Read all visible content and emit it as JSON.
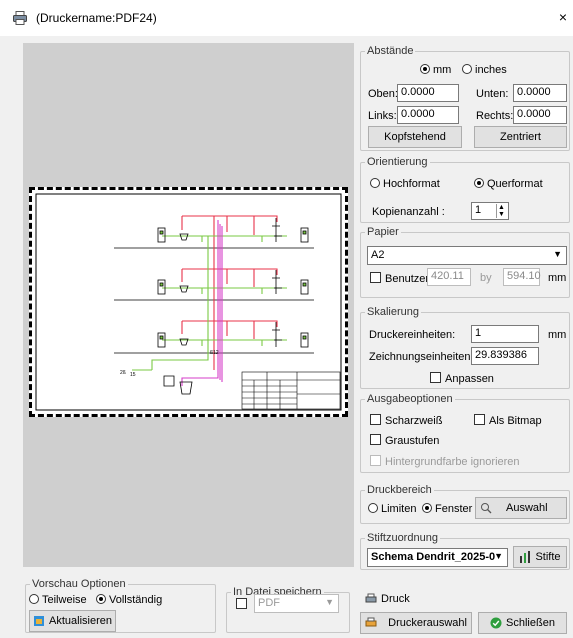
{
  "window": {
    "title": "(Druckername:PDF24)",
    "close": "×"
  },
  "abstaende": {
    "legend": "Abstände",
    "unit_mm": "mm",
    "unit_inches": "inches",
    "unit_selected": "mm",
    "oben_label": "Oben:",
    "oben": "0.0000",
    "unten_label": "Unten:",
    "unten": "0.0000",
    "links_label": "Links:",
    "links": "0.0000",
    "rechts_label": "Rechts:",
    "rechts": "0.0000",
    "kopfstehend": "Kopfstehend",
    "zentriert": "Zentriert"
  },
  "orientierung": {
    "legend": "Orientierung",
    "hochformat": "Hochformat",
    "querformat": "Querformat",
    "selected": "Querformat",
    "kopien_label": "Kopienanzahl :",
    "kopien": "1"
  },
  "papier": {
    "legend": "Papier",
    "format": "A2",
    "benutzer": "Benutzer",
    "width": "420.11",
    "by": "by",
    "height": "594.10",
    "unit": "mm"
  },
  "skalierung": {
    "legend": "Skalierung",
    "drucker_label": "Druckereinheiten:",
    "drucker": "1",
    "drucker_unit": "mm",
    "zeichnung_label": "Zeichnungseinheiten:",
    "zeichnung": "29.839386",
    "anpassen": "Anpassen"
  },
  "ausgabe": {
    "legend": "Ausgabeoptionen",
    "schwarzweiss": "Scharzweiß",
    "bitmap": "Als Bitmap",
    "graustufen": "Graustufen",
    "hintergrund": "Hintergrundfarbe ignorieren"
  },
  "druckbereich": {
    "legend": "Druckbereich",
    "limiten": "Limiten",
    "fenster": "Fenster",
    "auswahl": "Auswahl",
    "selected": "Fenster"
  },
  "stift": {
    "legend": "Stiftzuordnung",
    "schema": "Schema Dendrit_2025-0",
    "stifte": "Stifte"
  },
  "vorschau": {
    "legend": "Vorschau Optionen",
    "teilweise": "Teilweise",
    "vollstaendig": "Vollständig",
    "selected": "Vollständig",
    "aktualisieren": "Aktualisieren"
  },
  "datei": {
    "legend": "In Datei speichern",
    "format": "PDF"
  },
  "actions": {
    "druck": "Druck",
    "druckerauswahl": "Druckerauswahl",
    "schliessen": "Schließen"
  },
  "drawing": {
    "label_a": "15",
    "label_b": "2ß",
    "label_c": "ß12"
  },
  "colors": {
    "pipe_red": "#e8334a",
    "pipe_green": "#7ac943",
    "pipe_magenta": "#d63cc8",
    "accent_green": "#2e9e3e"
  }
}
